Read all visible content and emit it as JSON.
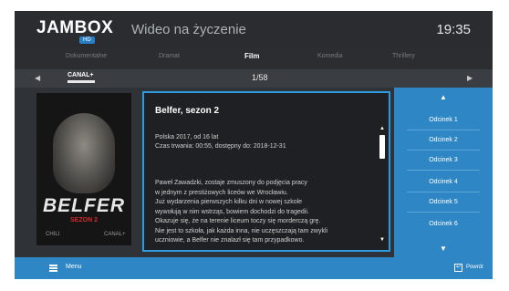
{
  "header": {
    "logo": "JAMBOX",
    "logo_badge": "HD",
    "title": "Wideo na życzenie",
    "clock": "19:35"
  },
  "categories": [
    "Dokumentalne",
    "Dramat",
    "Film",
    "Komedia",
    "Thrillery"
  ],
  "active_category": "Film",
  "channel": {
    "logo": "CANAL+",
    "counter": "1/58"
  },
  "poster": {
    "title": "BELFER",
    "subtitle": "SEZON 2",
    "footer_left": "CHILI",
    "footer_right": "CANAL+"
  },
  "detail": {
    "title": "Belfer, sezon 2",
    "meta_line1": "Polska 2017, od 16 lat",
    "meta_line2": "Czas trwania: 00:55, dostępny do: 2018-12-31",
    "description_lines": [
      "Paweł Zawadzki, zostaje zmuszony do podjęcia pracy",
      "w jednym z prestiżowych liceów we Wrocławiu.",
      "Już wydarzenia pierwszych kilku dni w nowej szkole",
      "wywołują w nim wstrząs, bowiem dochodzi do tragedii.",
      "Okazuje się, że na terenie liceum toczy się morderczą grę.",
      "Nie jest to szkoła, jak każda inna, nie uczęszczają tam zwykli",
      "uczniowie, a Belfer nie znalazł się tam przypadkowo."
    ]
  },
  "episodes": [
    "Odcinek 1",
    "Odcinek 2",
    "Odcinek 3",
    "Odcinek 4",
    "Odcinek 5",
    "Odcinek 6"
  ],
  "footer": {
    "menu_label": "Menu",
    "back_label": "Powrót"
  },
  "colors": {
    "accent": "#2f86c4",
    "focus_border": "#2e9be0",
    "background": "#2b2d31"
  }
}
